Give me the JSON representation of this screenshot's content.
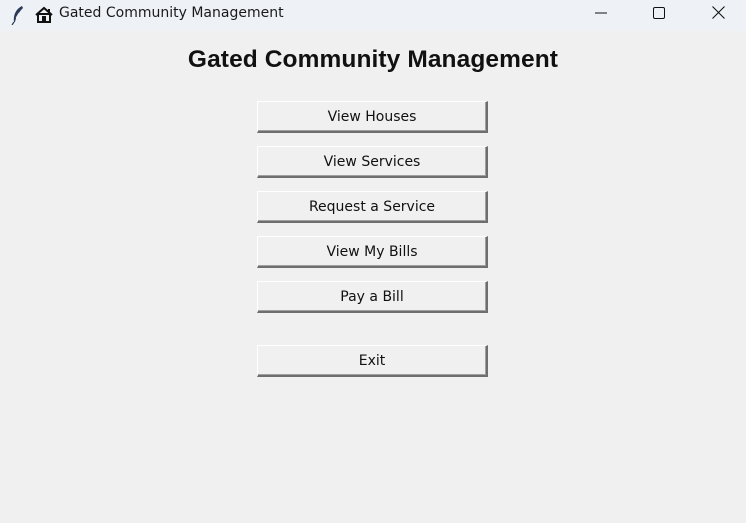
{
  "window": {
    "title": "Gated Community Management",
    "controls": {
      "minimize_icon": "minimize-icon",
      "maximize_icon": "maximize-icon",
      "close_icon": "close-icon"
    },
    "icons": [
      "feather-icon",
      "house-icon"
    ]
  },
  "main": {
    "heading": "Gated Community Management",
    "buttons": [
      {
        "label": "View Houses"
      },
      {
        "label": "View Services"
      },
      {
        "label": "Request a Service"
      },
      {
        "label": "View My Bills"
      },
      {
        "label": "Pay a Bill"
      },
      {
        "label": "Exit"
      }
    ]
  },
  "colors": {
    "background": "#f0f0f0",
    "titlebar": "#eef1f5",
    "text": "#111111"
  }
}
